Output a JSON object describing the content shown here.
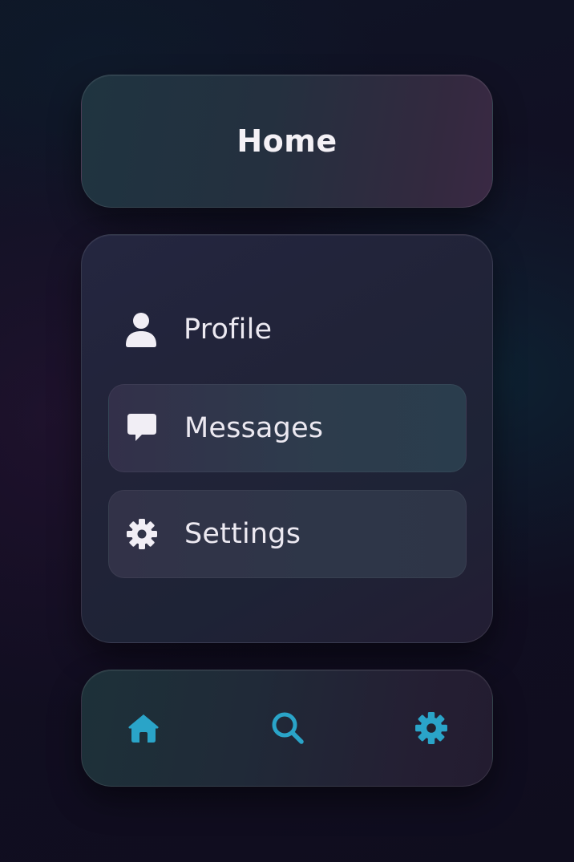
{
  "header": {
    "title": "Home"
  },
  "menu": {
    "items": [
      {
        "label": "Profile",
        "icon": "person-icon",
        "state": "default"
      },
      {
        "label": "Messages",
        "icon": "chat-bubble-icon",
        "state": "highlighted"
      },
      {
        "label": "Settings",
        "icon": "gear-icon",
        "state": "highlighted"
      }
    ]
  },
  "bottom_nav": {
    "items": [
      {
        "name": "home",
        "icon": "home-icon"
      },
      {
        "name": "search",
        "icon": "search-icon"
      },
      {
        "name": "settings",
        "icon": "gear-icon"
      }
    ]
  },
  "colors": {
    "accent": "#2aa4c8",
    "text": "#ece9f1",
    "background": "#120e22"
  }
}
